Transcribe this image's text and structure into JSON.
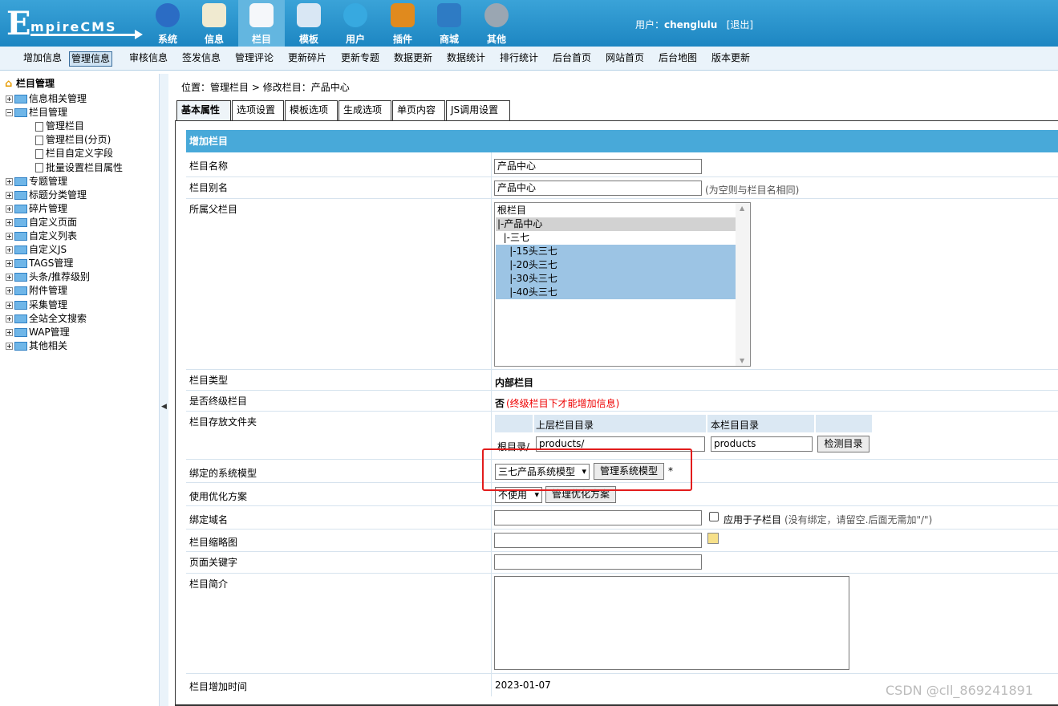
{
  "header": {
    "logo_text_big": "E",
    "logo_text_rest": "mpireCMS",
    "nav": [
      {
        "label": "系统",
        "icon": "globe-icon",
        "color": "#2b6cc4"
      },
      {
        "label": "信息",
        "icon": "notepad-icon",
        "color": "#f0ead0"
      },
      {
        "label": "栏目",
        "icon": "folder-icon",
        "color": "#f5f7fa"
      },
      {
        "label": "模板",
        "icon": "window-icon",
        "color": "#d9e7f4"
      },
      {
        "label": "用户",
        "icon": "user-icon",
        "color": "#37a9e0"
      },
      {
        "label": "插件",
        "icon": "tools-icon",
        "color": "#e08a1e"
      },
      {
        "label": "商城",
        "icon": "card-icon",
        "color": "#2e7bc4"
      },
      {
        "label": "其他",
        "icon": "gear-icon",
        "color": "#9aa6b2"
      }
    ],
    "user_prefix": "用户：",
    "username": "chenglulu",
    "logout": "[退出]"
  },
  "subnav": [
    "增加信息",
    "管理信息",
    "审核信息",
    "签发信息",
    "管理评论",
    "更新碎片",
    "更新专题",
    "数据更新",
    "数据统计",
    "排行统计",
    "后台首页",
    "网站首页",
    "后台地图",
    "版本更新"
  ],
  "sidebar": {
    "root": "栏目管理",
    "items": [
      {
        "label": "信息相关管理",
        "type": "folder",
        "expanded": false
      },
      {
        "label": "栏目管理",
        "type": "folder",
        "expanded": true
      },
      {
        "label": "管理栏目",
        "type": "page"
      },
      {
        "label": "管理栏目(分页)",
        "type": "page"
      },
      {
        "label": "栏目自定义字段",
        "type": "page"
      },
      {
        "label": "批量设置栏目属性",
        "type": "page"
      },
      {
        "label": "专题管理",
        "type": "folder",
        "expanded": false
      },
      {
        "label": "标题分类管理",
        "type": "folder",
        "expanded": false
      },
      {
        "label": "碎片管理",
        "type": "folder",
        "expanded": false
      },
      {
        "label": "自定义页面",
        "type": "folder",
        "expanded": false
      },
      {
        "label": "自定义列表",
        "type": "folder",
        "expanded": false
      },
      {
        "label": "自定义JS",
        "type": "folder",
        "expanded": false
      },
      {
        "label": "TAGS管理",
        "type": "folder",
        "expanded": false
      },
      {
        "label": "头条/推荐级别",
        "type": "folder",
        "expanded": false
      },
      {
        "label": "附件管理",
        "type": "folder",
        "expanded": false
      },
      {
        "label": "采集管理",
        "type": "folder",
        "expanded": false
      },
      {
        "label": "全站全文搜索",
        "type": "folder",
        "expanded": false
      },
      {
        "label": "WAP管理",
        "type": "folder",
        "expanded": false
      },
      {
        "label": "其他相关",
        "type": "folder",
        "expanded": false
      }
    ]
  },
  "breadcrumb": {
    "prefix": "位置：",
    "link": "管理栏目",
    "rest": " > 修改栏目：产品中心"
  },
  "tabs": [
    "基本属性",
    "选项设置",
    "模板选项",
    "生成选项",
    "单页内容",
    "JS调用设置"
  ],
  "form": {
    "heading": "增加栏目",
    "name_label": "栏目名称",
    "name_value": "产品中心",
    "alias_label": "栏目别名",
    "alias_value": "产品中心",
    "alias_hint": "(为空则与栏目名相同)",
    "parent_label": "所属父栏目",
    "parent_options": [
      "根栏目",
      "|-产品中心",
      "  |-三七",
      "    |-15头三七",
      "    |-20头三七",
      "    |-30头三七",
      "    |-40头三七"
    ],
    "type_label": "栏目类型",
    "type_value": "内部栏目",
    "final_label": "是否终级栏目",
    "final_value": "否",
    "final_hint": "(终级栏目下才能增加信息)",
    "folder_label": "栏目存放文件夹",
    "folder_col1": "上层栏目目录",
    "folder_col2": "本栏目目录",
    "folder_root": "根目录/",
    "folder_parent_value": "products/",
    "folder_self_value": "products",
    "folder_check_btn": "检测目录",
    "model_label": "绑定的系统模型",
    "model_value": "三七产品系统模型",
    "model_btn": "管理系统模型",
    "model_star": "*",
    "opt_label": "使用优化方案",
    "opt_value": "不使用",
    "opt_btn": "管理优化方案",
    "domain_label": "绑定域名",
    "domain_value": "",
    "domain_cb_label": "应用于子栏目",
    "domain_hint": "(没有绑定，请留空.后面无需加\"/\")",
    "thumb_label": "栏目缩略图",
    "keywords_label": "页面关键字",
    "intro_label": "栏目简介",
    "addtime_label": "栏目增加时间",
    "addtime_value": "2023-01-07"
  },
  "watermark": "CSDN @cll_869241891"
}
